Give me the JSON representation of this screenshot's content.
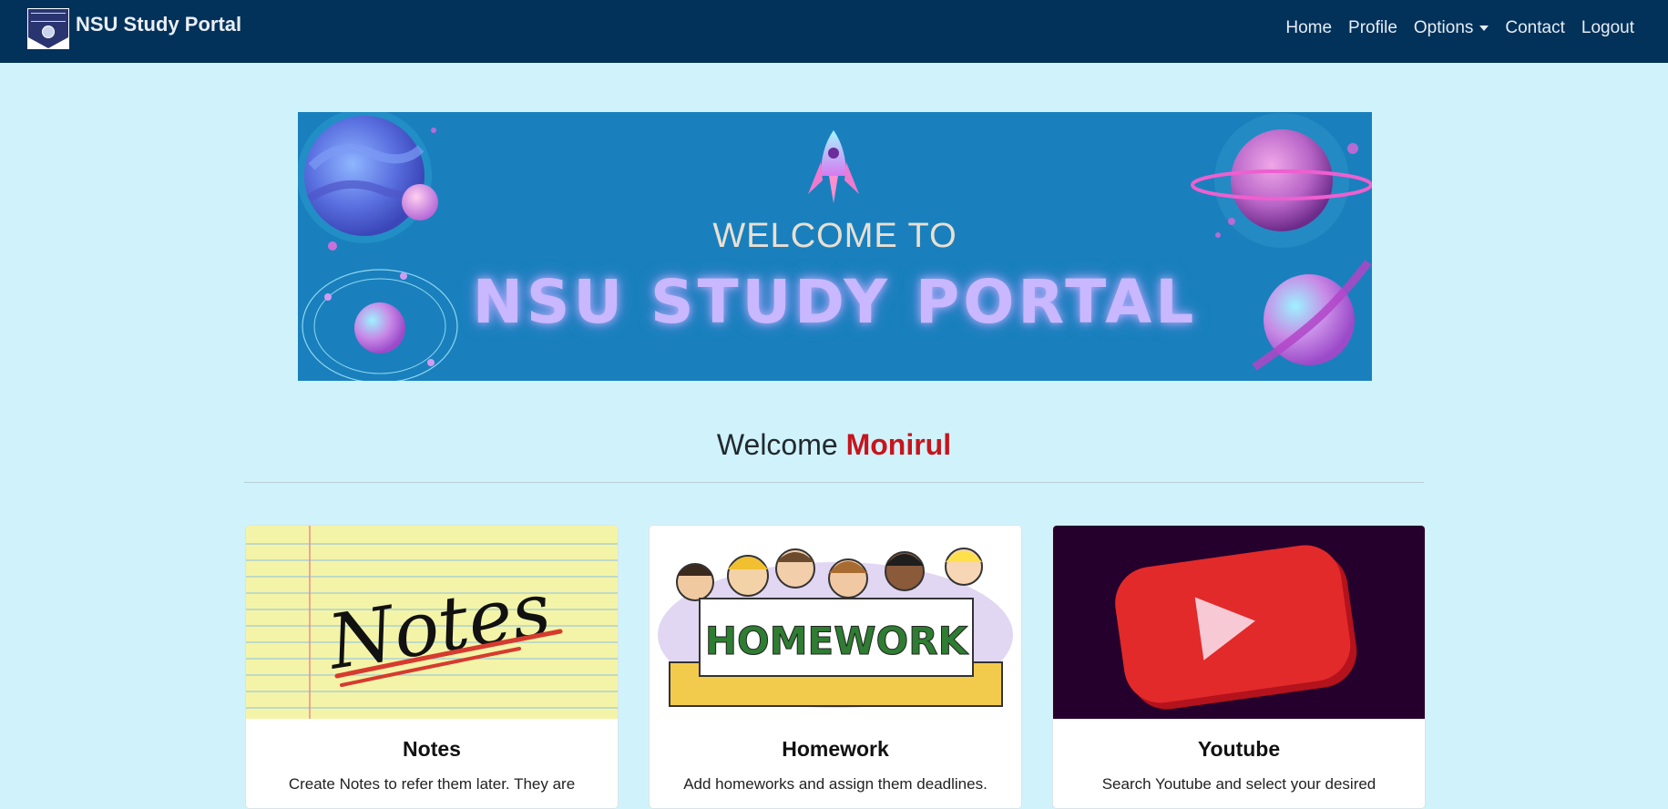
{
  "navbar": {
    "brand": "NSU Study Portal",
    "links": [
      {
        "label": "Home"
      },
      {
        "label": "Profile"
      },
      {
        "label": "Options"
      },
      {
        "label": "Contact"
      },
      {
        "label": "Logout"
      }
    ]
  },
  "banner": {
    "welcome": "WELCOME TO",
    "title": "NSU STUDY PORTAL"
  },
  "welcome": {
    "greeting": "Welcome",
    "username": "Monirul"
  },
  "cards": [
    {
      "image_text": "Notes",
      "title": "Notes",
      "text": "Create Notes to refer them later. They are"
    },
    {
      "image_text": "HOMEWORK",
      "title": "Homework",
      "text": "Add homeworks and assign them deadlines."
    },
    {
      "title": "Youtube",
      "text": "Search Youtube and select your desired"
    }
  ],
  "colors": {
    "navbar": "#02315a",
    "page_bg": "#d0f3fb",
    "banner_bg": "#1980bd",
    "username": "#c8141c"
  },
  "icons": [
    "nsu-logo-icon",
    "dropdown-caret-icon",
    "rocket-icon",
    "planet-icon",
    "play-icon"
  ]
}
